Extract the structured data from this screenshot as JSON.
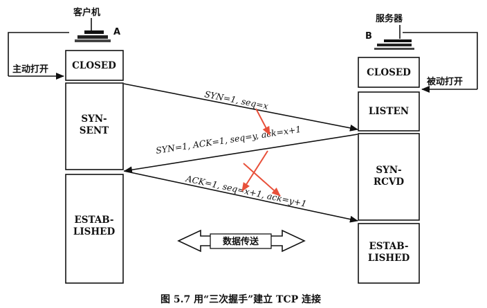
{
  "client": {
    "name": "客户机",
    "marker": "A",
    "action": "主动打开",
    "states": [
      "CLOSED",
      "SYN-\nSENT",
      "ESTAB-\nLISHED"
    ]
  },
  "server": {
    "name": "服务器",
    "marker": "B",
    "action": "被动打开",
    "states": [
      "CLOSED",
      "LISTEN",
      "SYN-\nRCVD",
      "ESTAB-\nLISHED"
    ]
  },
  "messages": [
    "SYN=1, seq=x",
    "SYN=1, ACK=1, seq=y, ack=x+1",
    "ACK=1, seq=x+1, ack=y+1"
  ],
  "transfer_label": "数据传送",
  "caption": "图 5.7   用“三次握手”建立 TCP 连接",
  "colors": {
    "ink": "#111111",
    "annotation": "#e8503a"
  }
}
